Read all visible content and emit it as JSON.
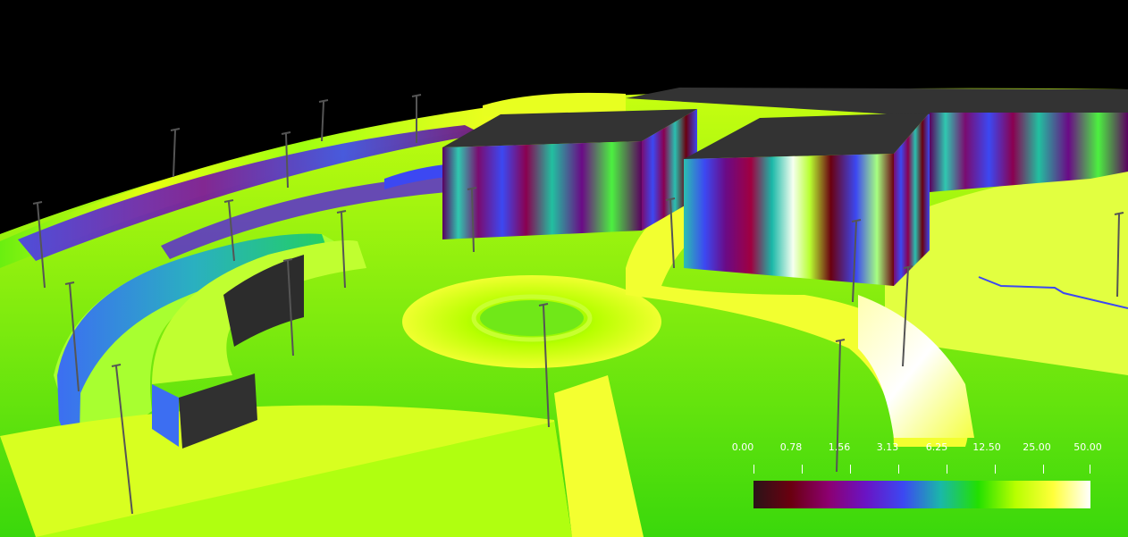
{
  "view": {
    "background": "#000000",
    "scene": "3D illuminance false-color rendering of roads, roundabout and buildings with pole lights",
    "building_roof_color": "#333333"
  },
  "colors": {
    "ground_base": "#5ce01c",
    "bright_yellow": "#f2ff00",
    "lime": "#b8ff00",
    "green": "#22e000",
    "blue": "#3c48f2",
    "purple": "#6a0a86",
    "dark_red": "#6a0010"
  },
  "legend": {
    "scale_labels": [
      "0.00",
      "0.78",
      "1.56",
      "3.13",
      "6.25",
      "12.50",
      "25.00",
      "50.00"
    ],
    "gradient": [
      "#2a1418",
      "#6a0010",
      "#8c0070",
      "#6a14c4",
      "#3c48f2",
      "#1ab8a8",
      "#22e000",
      "#b8ff00",
      "#ffff3a",
      "#ffffff"
    ]
  }
}
